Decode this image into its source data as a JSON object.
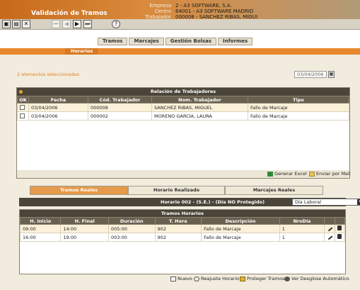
{
  "title": "Validación de Tramos",
  "info": {
    "labels": [
      "Empresa",
      "Centro",
      "Trabajador"
    ],
    "values": [
      "2 - A3 SOFTWARE, S.A.",
      "64001 - A3 SOFTWARE MADRID",
      "000008 - SANCHEZ RIBAS, MIGUI"
    ]
  },
  "toolbar": {
    "icons": [
      "save-icon",
      "save-close-icon",
      "close-icon",
      "first-icon",
      "prev-icon",
      "next-icon",
      "last-icon",
      "help-icon"
    ]
  },
  "main_tabs": [
    "Tramos",
    "Marcajes",
    "Gestión Bolsas",
    "Informes"
  ],
  "sub_tab": "Horarios",
  "selection_text": "2 elementos seleccionados",
  "date_value": "03/04/2006",
  "workers_panel": {
    "title": "Relación de Trabajadores",
    "columns": [
      "OK",
      "Fecha",
      "Cód. Trabajador",
      "Nom. Trabajador",
      "Tipo"
    ],
    "rows": [
      {
        "fecha": "03/04/2006",
        "cod": "000008",
        "nom": "SANCHEZ RIBAS, MIGUEL",
        "tipo": "Fallo de Marcaje"
      },
      {
        "fecha": "03/04/2006",
        "cod": "000002",
        "nom": "MORENO GARCÍA, LAURA",
        "tipo": "Fallo de Marcaje"
      }
    ],
    "generar_excel": "Generar Excel",
    "enviar_mail": "Enviar por Mail"
  },
  "sec_tabs": [
    "Tramos Reales",
    "Horario Realizado",
    "Marcajes Reales"
  ],
  "horario": {
    "label": "Horario 002 - (S.E.) - (Día NO Protegido)",
    "select_value": "Día Laboral"
  },
  "tramos_panel": {
    "title": "Tramos Horarios",
    "columns": [
      "H. Inicio",
      "H. Final",
      "Duración",
      "T. Hora",
      "Descripción",
      "NroDía"
    ],
    "rows": [
      {
        "inicio": "09:00",
        "final": "14:00",
        "duracion": "005:00",
        "thora": "902",
        "desc": "Fallo de Marcaje",
        "nrodia": "1"
      },
      {
        "inicio": "16:00",
        "final": "19:00",
        "duracion": "003:00",
        "thora": "902",
        "desc": "Fallo de Marcaje",
        "nrodia": "1"
      }
    ]
  },
  "footer_actions": [
    "Nuevo",
    "Reajuste Horario",
    "Proteger Tramos",
    "Ver Desglose Automático"
  ]
}
